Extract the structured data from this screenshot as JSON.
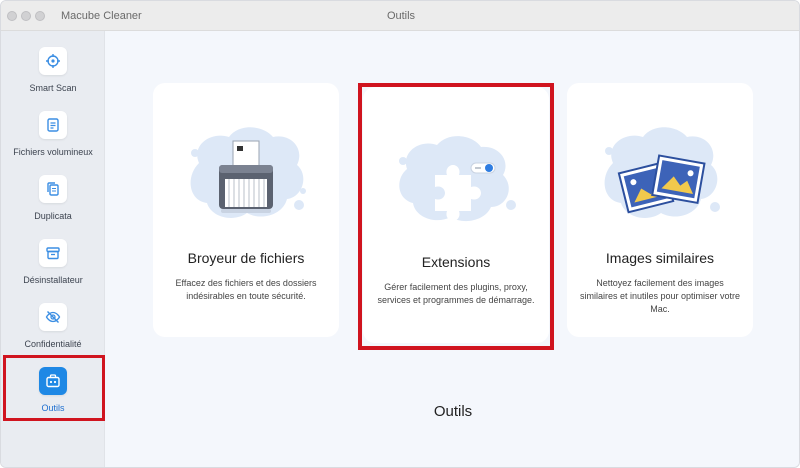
{
  "window": {
    "app_name": "Macube Cleaner",
    "title": "Outils"
  },
  "sidebar": {
    "items": [
      {
        "label": "Smart Scan",
        "icon": "target-icon"
      },
      {
        "label": "Fichiers volumineux",
        "icon": "document-icon"
      },
      {
        "label": "Duplicata",
        "icon": "copy-icon"
      },
      {
        "label": "Désinstallateur",
        "icon": "box-icon"
      },
      {
        "label": "Confidentialité",
        "icon": "eye-slash-icon"
      },
      {
        "label": "Outils",
        "icon": "toolbox-icon",
        "active": true
      }
    ]
  },
  "tools": [
    {
      "title": "Broyeur de fichiers",
      "description": "Effacez des fichiers et des dossiers indésirables en toute sécurité.",
      "icon": "shredder-icon"
    },
    {
      "title": "Extensions",
      "description": "Gérer facilement des plugins, proxy, services et programmes de démarrage.",
      "icon": "puzzle-icon"
    },
    {
      "title": "Images similaires",
      "description": "Nettoyez facilement des images similaires et inutiles pour optimiser votre Mac.",
      "icon": "photos-icon"
    }
  ],
  "page_heading": "Outils",
  "colors": {
    "accent": "#1e88e5",
    "highlight": "#d0141f",
    "blob": "#dde8f7"
  }
}
